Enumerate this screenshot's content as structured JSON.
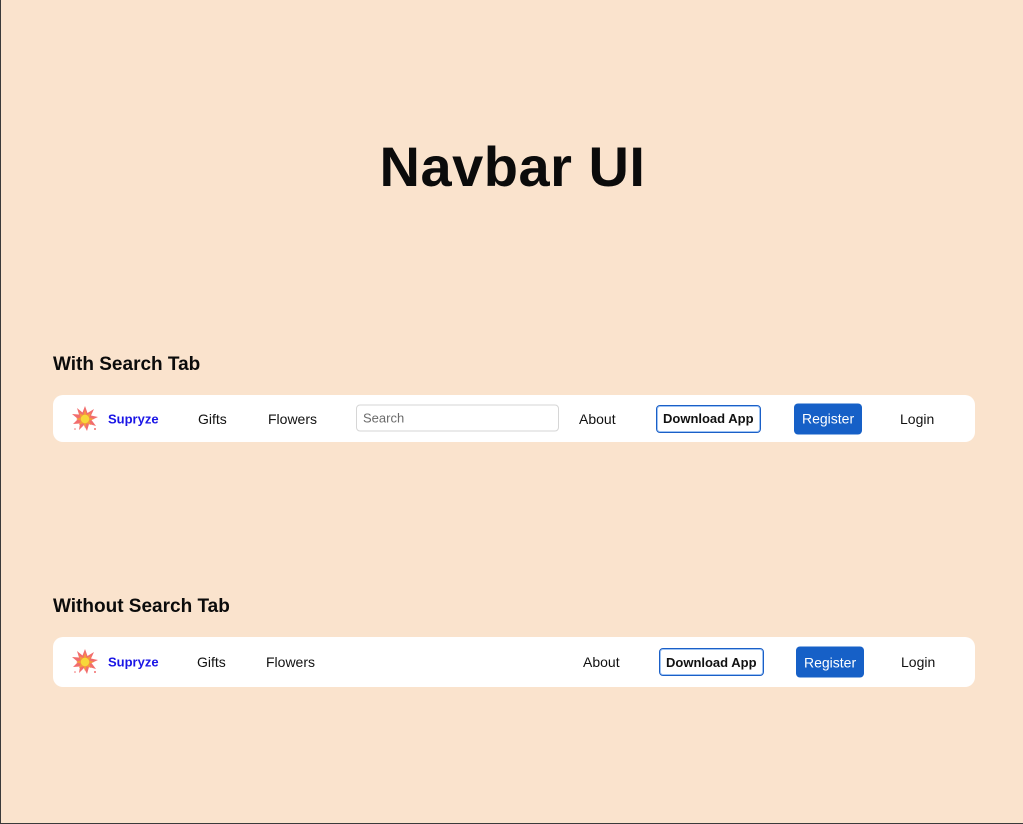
{
  "page": {
    "title": "Navbar UI"
  },
  "sections": [
    {
      "heading": "With Search Tab",
      "navbar": {
        "brand": "Supryze",
        "links": [
          "Gifts",
          "Flowers"
        ],
        "search_placeholder": "Search",
        "about": "About",
        "download_button": "Download App",
        "register_button": "Register",
        "login": "Login"
      }
    },
    {
      "heading": "Without Search Tab",
      "navbar": {
        "brand": "Supryze",
        "links": [
          "Gifts",
          "Flowers"
        ],
        "about": "About",
        "download_button": "Download App",
        "register_button": "Register",
        "login": "Login"
      }
    }
  ],
  "icons": {
    "logo": "starburst-logo-icon"
  },
  "colors": {
    "page_background": "#fae3cd",
    "navbar_background": "#ffffff",
    "brand_text": "#1a15e6",
    "register_button": "#1660c7",
    "download_border": "#1a5fc7"
  }
}
